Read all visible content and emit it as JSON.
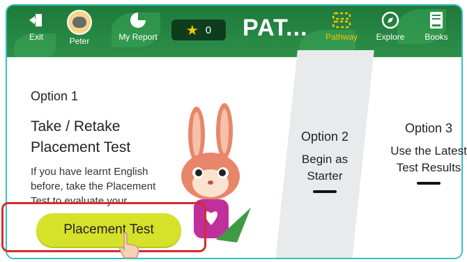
{
  "header": {
    "title": "PAT...",
    "stars": "0",
    "nav": {
      "exit": "Exit",
      "user": "Peter",
      "report": "My Report",
      "pathway": "Pathway",
      "explore": "Explore",
      "books": "Books"
    }
  },
  "options": {
    "one": {
      "label": "Option 1",
      "title": "Take / Retake Placement Test",
      "description": "If you have learnt English before, take the Placement Test to evaluate your proficiency in different",
      "button": "Placement Test"
    },
    "two": {
      "label": "Option 2",
      "text": "Begin as Starter"
    },
    "three": {
      "label": "Option 3",
      "text": "Use the Latest Test Results"
    }
  },
  "colors": {
    "topbar": "#2c8f48",
    "accent": "#f5c400",
    "button": "#d6e22a",
    "highlight": "#d52b2b",
    "frame": "#33c0c0"
  },
  "icons": [
    "exit-icon",
    "user-avatar",
    "report-pie-icon",
    "star-icon",
    "pathway-icon",
    "explore-compass-icon",
    "books-icon",
    "bunny-mascot",
    "hand-pointer-icon"
  ]
}
